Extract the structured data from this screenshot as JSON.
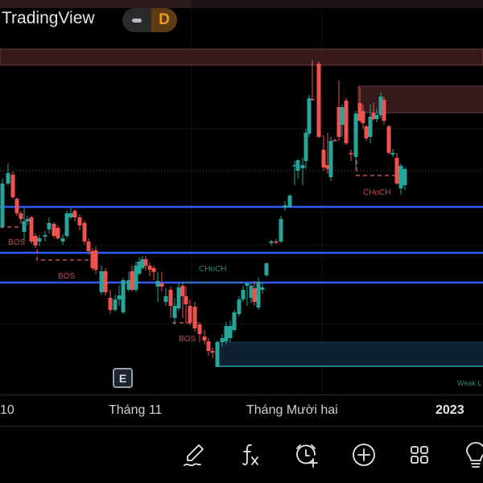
{
  "header": {
    "app_title": "TradingView",
    "interval_label": "D"
  },
  "chart": {
    "annotations": {
      "bos_1": "BOS",
      "bos_2": "BOS",
      "bos_3": "BOS",
      "choch_bull": "CHoCH",
      "choch_bear": "CHoCH",
      "weak_low": "Weak L"
    },
    "earnings_badge": "E",
    "x_axis": [
      "10",
      "Tháng 11",
      "Tháng Mười hai",
      "2023"
    ],
    "colors": {
      "up": "#26a69a",
      "down": "#ef5350",
      "level_line": "#2f5bff",
      "bos": "#c44c4c",
      "choch_bull": "#2a8a73"
    }
  },
  "toolbar": {
    "items": [
      "drawing-tools",
      "indicators",
      "add-alert",
      "add",
      "layouts",
      "ideas"
    ]
  }
}
